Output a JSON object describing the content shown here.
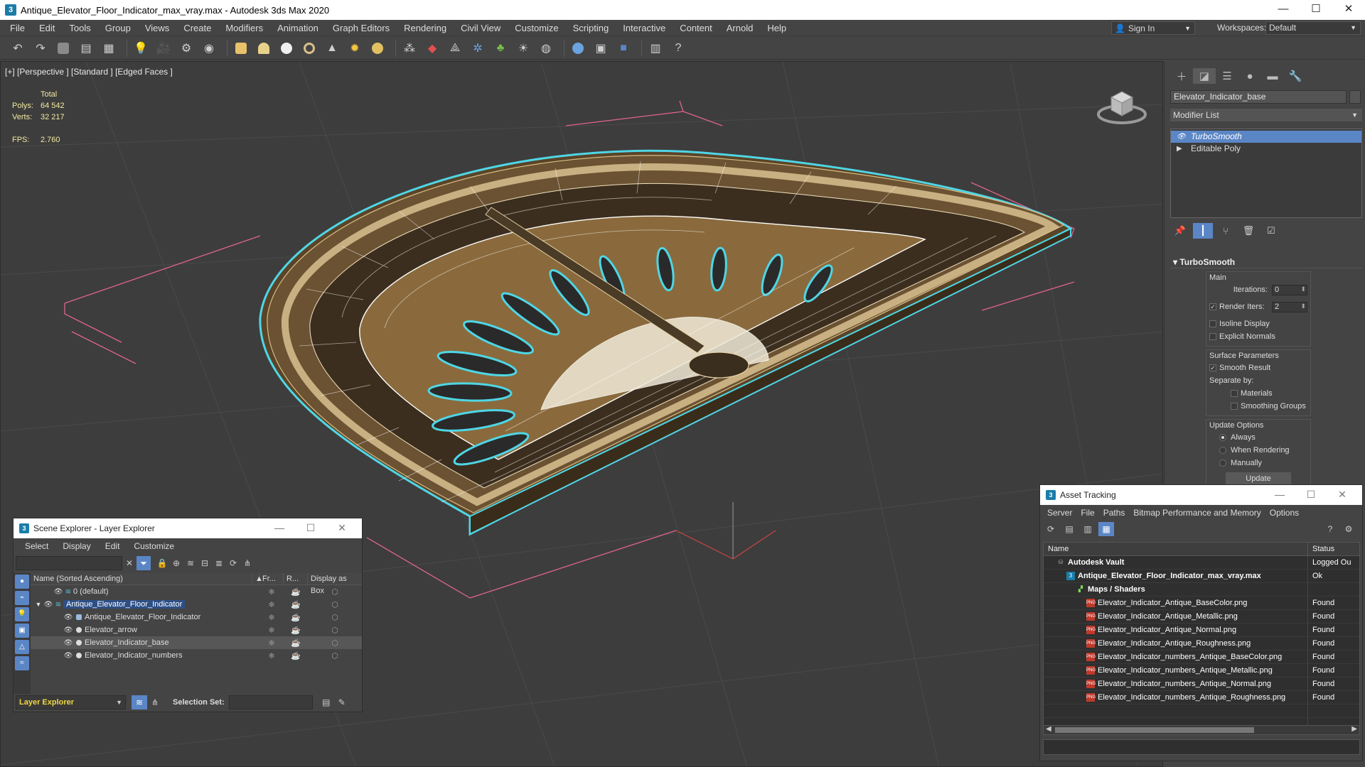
{
  "window": {
    "title": "Antique_Elevator_Floor_Indicator_max_vray.max - Autodesk 3ds Max 2020",
    "app_icon_letter": "3"
  },
  "menu": [
    "File",
    "Edit",
    "Tools",
    "Group",
    "Views",
    "Create",
    "Modifiers",
    "Animation",
    "Graph Editors",
    "Rendering",
    "Civil View",
    "Customize",
    "Scripting",
    "Interactive",
    "Content",
    "Arnold",
    "Help"
  ],
  "signin": {
    "label": "Sign In"
  },
  "workspaces": {
    "label": "Workspaces:",
    "value": "Default"
  },
  "viewport": {
    "label": "[+] [Perspective ] [Standard ] [Edged Faces ]",
    "stats": {
      "total_label": "Total",
      "polys_label": "Polys:",
      "polys": "64 542",
      "verts_label": "Verts:",
      "verts": "32 217",
      "fps_label": "FPS:",
      "fps": "2.760"
    }
  },
  "command_panel": {
    "object_name": "Elevator_Indicator_base",
    "modifier_list": "Modifier List",
    "stack": [
      {
        "label": "TurboSmooth",
        "selected": true
      },
      {
        "label": "Editable Poly",
        "selected": false
      }
    ],
    "rollout_title": "TurboSmooth",
    "main_group": "Main",
    "iterations_label": "Iterations:",
    "iterations_value": "0",
    "render_iters_label": "Render Iters:",
    "render_iters_value": "2",
    "isoline_label": "Isoline Display",
    "explicit_normals_label": "Explicit Normals",
    "surface_group": "Surface Parameters",
    "smooth_result_label": "Smooth Result",
    "separate_by_label": "Separate by:",
    "materials_label": "Materials",
    "smoothing_groups_label": "Smoothing Groups",
    "update_group": "Update Options",
    "always_label": "Always",
    "when_rendering_label": "When Rendering",
    "manually_label": "Manually",
    "update_button": "Update"
  },
  "scene_explorer": {
    "title": "Scene Explorer - Layer Explorer",
    "menu": [
      "Select",
      "Display",
      "Edit",
      "Customize"
    ],
    "columns": {
      "name": "Name (Sorted Ascending)",
      "fr": "Fr...",
      "r": "R...",
      "box": "Display as Box"
    },
    "rows": [
      {
        "label": "0 (default)",
        "indent": 1,
        "type": "layer",
        "selected": false,
        "highlighted": false,
        "expand": ""
      },
      {
        "label": "Antique_Elevator_Floor_Indicator",
        "indent": 0,
        "type": "layer",
        "selected": false,
        "highlighted": true,
        "expand": "▼"
      },
      {
        "label": "Antique_Elevator_Floor_Indicator",
        "indent": 2,
        "type": "group",
        "selected": false,
        "highlighted": false,
        "expand": ""
      },
      {
        "label": "Elevator_arrow",
        "indent": 2,
        "type": "object",
        "selected": false,
        "highlighted": false,
        "expand": ""
      },
      {
        "label": "Elevator_Indicator_base",
        "indent": 2,
        "type": "object",
        "selected": true,
        "highlighted": false,
        "expand": ""
      },
      {
        "label": "Elevator_Indicator_numbers",
        "indent": 2,
        "type": "object",
        "selected": false,
        "highlighted": false,
        "expand": ""
      }
    ],
    "layer_explorer_label": "Layer Explorer",
    "selection_set_label": "Selection Set:"
  },
  "asset_tracking": {
    "title": "Asset Tracking",
    "menu": [
      "Server",
      "File",
      "Paths",
      "Bitmap Performance and Memory",
      "Options"
    ],
    "columns": {
      "name": "Name",
      "status": "Status"
    },
    "rows": [
      {
        "name": "Autodesk Vault",
        "status": "Logged Ou",
        "indent": 1,
        "icon": "vault"
      },
      {
        "name": "Antique_Elevator_Floor_Indicator_max_vray.max",
        "status": "Ok",
        "indent": 2,
        "icon": "max"
      },
      {
        "name": "Maps / Shaders",
        "status": "",
        "indent": 3,
        "icon": "maps"
      },
      {
        "name": "Elevator_Indicator_Antique_BaseColor.png",
        "status": "Found",
        "indent": 4,
        "icon": "png"
      },
      {
        "name": "Elevator_Indicator_Antique_Metallic.png",
        "status": "Found",
        "indent": 4,
        "icon": "png"
      },
      {
        "name": "Elevator_Indicator_Antique_Normal.png",
        "status": "Found",
        "indent": 4,
        "icon": "png"
      },
      {
        "name": "Elevator_Indicator_Antique_Roughness.png",
        "status": "Found",
        "indent": 4,
        "icon": "png"
      },
      {
        "name": "Elevator_Indicator_numbers_Antique_BaseColor.png",
        "status": "Found",
        "indent": 4,
        "icon": "png"
      },
      {
        "name": "Elevator_Indicator_numbers_Antique_Metallic.png",
        "status": "Found",
        "indent": 4,
        "icon": "png"
      },
      {
        "name": "Elevator_Indicator_numbers_Antique_Normal.png",
        "status": "Found",
        "indent": 4,
        "icon": "png"
      },
      {
        "name": "Elevator_Indicator_numbers_Antique_Roughness.png",
        "status": "Found",
        "indent": 4,
        "icon": "png"
      }
    ]
  },
  "colors": {
    "accent": "#5b86c6",
    "selection_outline": "#4fd6e6",
    "wire": "#ffffff",
    "brass": "#c9a15a",
    "stats_text": "#f3e9a2"
  }
}
